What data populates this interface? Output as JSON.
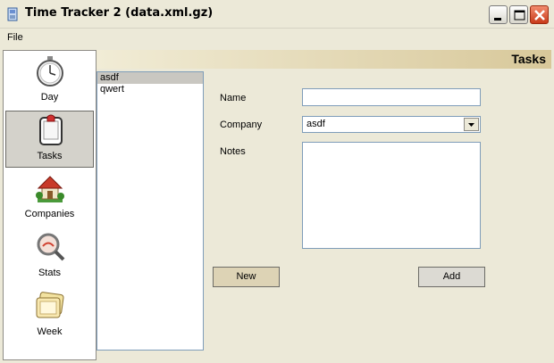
{
  "window": {
    "title": "Time Tracker 2 (data.xml.gz)"
  },
  "menu": {
    "file": "File"
  },
  "sidebar": {
    "items": [
      {
        "label": "Day",
        "icon": "stopwatch-icon",
        "selected": false
      },
      {
        "label": "Tasks",
        "icon": "clipboard-icon",
        "selected": true
      },
      {
        "label": "Companies",
        "icon": "house-icon",
        "selected": false
      },
      {
        "label": "Stats",
        "icon": "magnifier-icon",
        "selected": false
      },
      {
        "label": "Week",
        "icon": "folder-icon",
        "selected": false
      }
    ]
  },
  "header": {
    "title": "Tasks"
  },
  "tasks": [
    "asdf",
    "qwert"
  ],
  "selected_task": "asdf",
  "form": {
    "name_label": "Name",
    "name_value": "",
    "company_label": "Company",
    "company_value": "asdf",
    "notes_label": "Notes",
    "notes_value": ""
  },
  "buttons": {
    "new": "New",
    "add": "Add"
  },
  "colors": {
    "banner_start": "#f1ecd6",
    "banner_end": "#d8c89a",
    "window_bg": "#ece9d8"
  }
}
